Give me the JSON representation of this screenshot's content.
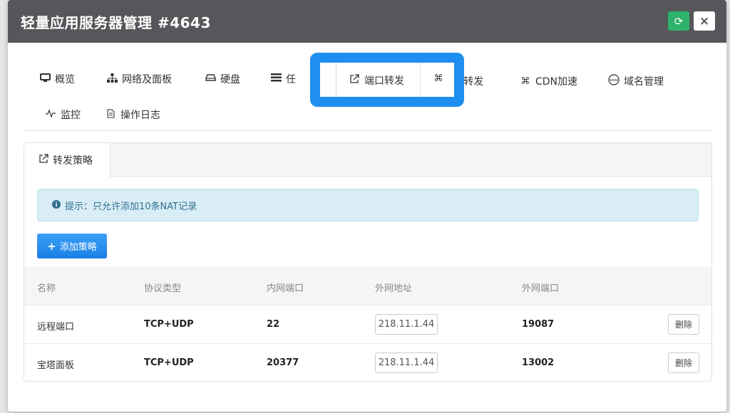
{
  "dialog": {
    "title": "轻量应用服务器管理 #4643",
    "refresh_icon": "refresh-icon",
    "close_label": "×"
  },
  "nav": {
    "items": [
      {
        "label": "概览",
        "icon": "monitor-icon"
      },
      {
        "label": "网络及面板",
        "icon": "sitemap-icon"
      },
      {
        "label": "硬盘",
        "icon": "hdd-icon"
      },
      {
        "label": "任",
        "icon": "tasks-icon"
      },
      {
        "label": "端口转发",
        "icon": "external-link-icon"
      },
      {
        "label": "DN转发",
        "icon": "command-icon"
      },
      {
        "label": "CDN加速",
        "icon": "command-icon"
      },
      {
        "label": "域名管理",
        "icon": "www-icon"
      },
      {
        "label": "监控",
        "icon": "pulse-icon"
      },
      {
        "label": "操作日志",
        "icon": "file-icon"
      }
    ],
    "highlight_color": "#1e8ff0"
  },
  "panel": {
    "tab_label": "转发策略",
    "alert_text": "提示：只允许添加10条NAT记录",
    "add_button_label": "添加策略"
  },
  "table": {
    "headers": [
      "名称",
      "协议类型",
      "内网端口",
      "外网地址",
      "外网端口"
    ],
    "rows": [
      {
        "name": "远程端口",
        "protocol": "TCP+UDP",
        "internal_port": "22",
        "external_address": "218.11.1.44",
        "external_port": "19087",
        "action": "删除"
      },
      {
        "name": "宝塔面板",
        "protocol": "TCP+UDP",
        "internal_port": "20377",
        "external_address": "218.11.1.44",
        "external_port": "13002",
        "action": "删除"
      }
    ]
  },
  "colors": {
    "header_bg": "#56575a",
    "refresh_green": "#2db36b",
    "primary_blue": "#1a7fe6",
    "alert_bg": "#d9edf6"
  }
}
